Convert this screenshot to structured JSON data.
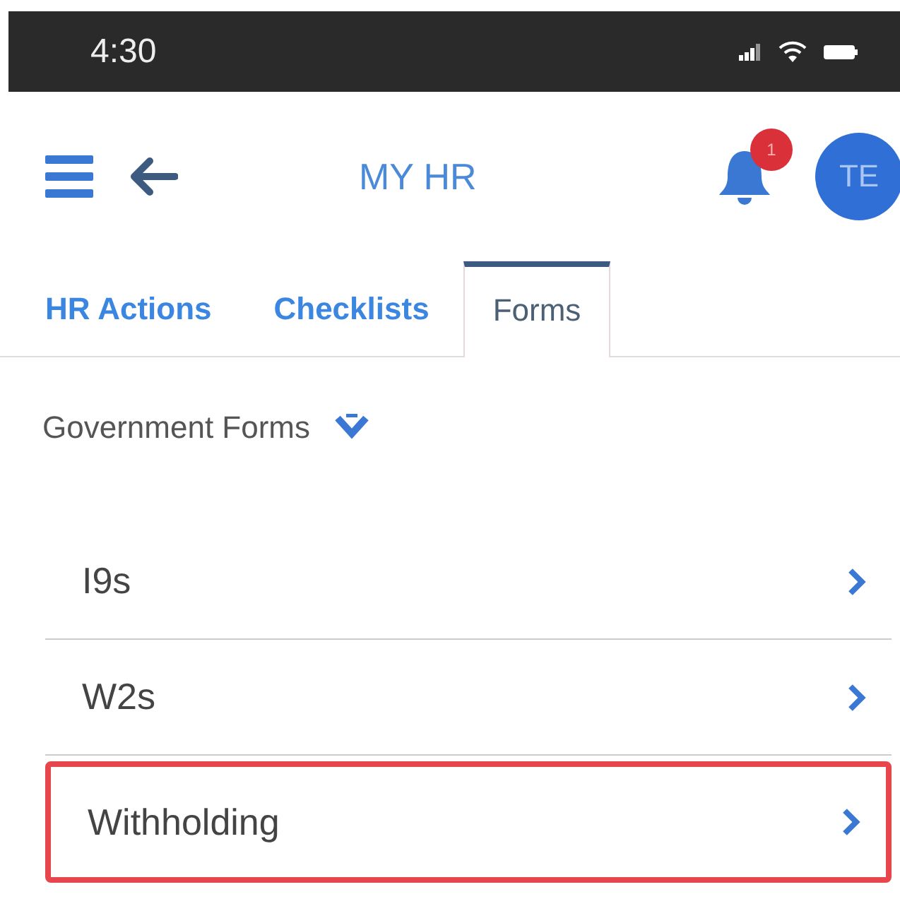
{
  "status_bar": {
    "time": "4:30"
  },
  "header": {
    "title": "MY HR",
    "notification_count": "1",
    "avatar_initials": "TE"
  },
  "tabs": [
    {
      "label": "HR Actions",
      "selected": false
    },
    {
      "label": "Checklists",
      "selected": false
    },
    {
      "label": "Forms",
      "selected": true
    }
  ],
  "section": {
    "title": "Government Forms",
    "expanded": true
  },
  "items": [
    {
      "label": "I9s",
      "highlighted": false
    },
    {
      "label": "W2s",
      "highlighted": false
    },
    {
      "label": "Withholding",
      "highlighted": true
    }
  ]
}
